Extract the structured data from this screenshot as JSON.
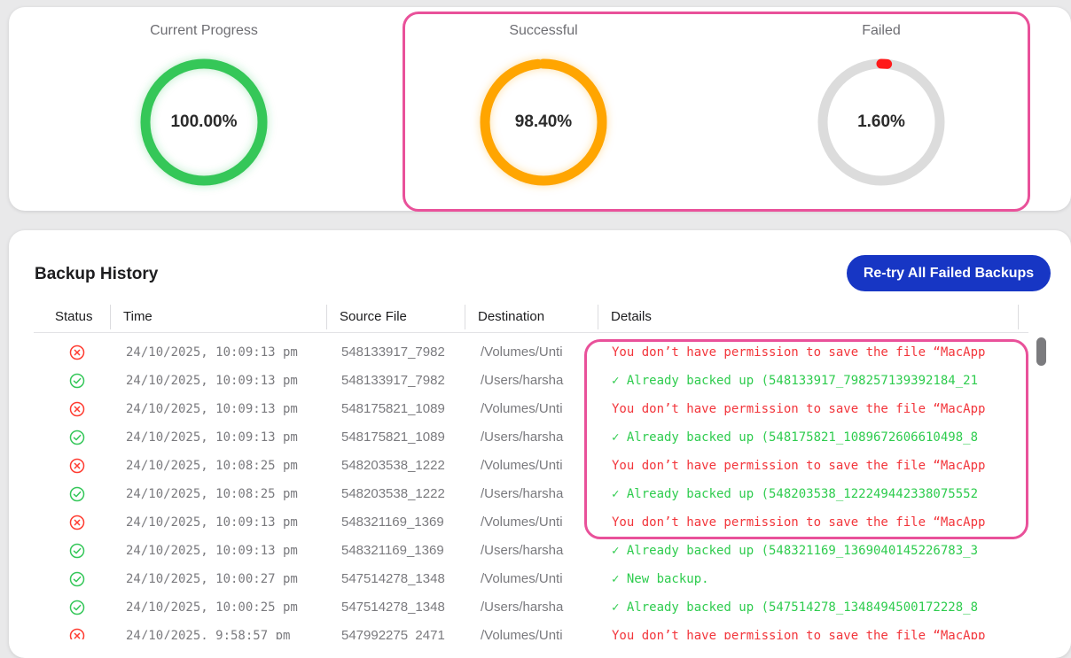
{
  "stats": {
    "progress": {
      "title": "Current Progress",
      "value_label": "100.00%",
      "fraction": 1.0,
      "color": "#34c759"
    },
    "successful": {
      "title": "Successful",
      "value_label": "98.40%",
      "fraction": 0.984,
      "color": "#ffa500"
    },
    "failed": {
      "title": "Failed",
      "value_label": "1.60%",
      "fraction": 0.016,
      "color": "#ff1a1a"
    },
    "track_color": "#dcdcdc"
  },
  "history": {
    "title": "Backup History",
    "retry_label": "Re-try All Failed Backups",
    "columns": {
      "status": "Status",
      "time": "Time",
      "source": "Source File",
      "destination": "Destination",
      "details": "Details"
    },
    "rows": [
      {
        "status": "failed",
        "time": "24/10/2025, 10:09:13 pm",
        "source": "548133917_7982",
        "destination": "/Volumes/Unti",
        "details": "You don’t have permission to save the file “MacApp"
      },
      {
        "status": "success",
        "time": "24/10/2025, 10:09:13 pm",
        "source": "548133917_7982",
        "destination": "/Users/harsha",
        "details": "✓ Already backed up (548133917_798257139392184_21"
      },
      {
        "status": "failed",
        "time": "24/10/2025, 10:09:13 pm",
        "source": "548175821_1089",
        "destination": "/Volumes/Unti",
        "details": "You don’t have permission to save the file “MacApp"
      },
      {
        "status": "success",
        "time": "24/10/2025, 10:09:13 pm",
        "source": "548175821_1089",
        "destination": "/Users/harsha",
        "details": "✓ Already backed up (548175821_1089672606610498_8"
      },
      {
        "status": "failed",
        "time": "24/10/2025, 10:08:25 pm",
        "source": "548203538_1222",
        "destination": "/Volumes/Unti",
        "details": "You don’t have permission to save the file “MacApp"
      },
      {
        "status": "success",
        "time": "24/10/2025, 10:08:25 pm",
        "source": "548203538_1222",
        "destination": "/Users/harsha",
        "details": "✓ Already backed up (548203538_122249442338075552"
      },
      {
        "status": "failed",
        "time": "24/10/2025, 10:09:13 pm",
        "source": "548321169_1369",
        "destination": "/Volumes/Unti",
        "details": "You don’t have permission to save the file “MacApp"
      },
      {
        "status": "success",
        "time": "24/10/2025, 10:09:13 pm",
        "source": "548321169_1369",
        "destination": "/Users/harsha",
        "details": "✓ Already backed up (548321169_1369040145226783_3"
      },
      {
        "status": "success",
        "time": "24/10/2025, 10:00:27 pm",
        "source": "547514278_1348",
        "destination": "/Volumes/Unti",
        "details": "✓ New backup."
      },
      {
        "status": "success",
        "time": "24/10/2025, 10:00:25 pm",
        "source": "547514278_1348",
        "destination": "/Users/harsha",
        "details": "✓ Already backed up (547514278_1348494500172228_8"
      },
      {
        "status": "failed",
        "time": "24/10/2025, 9:58:57 pm",
        "source": "547992275_2471",
        "destination": "/Volumes/Unti",
        "details": "You don’t have permission to save the file “MacApp"
      }
    ]
  },
  "status_colors": {
    "success": "#34c759",
    "failed": "#ff3b30"
  }
}
